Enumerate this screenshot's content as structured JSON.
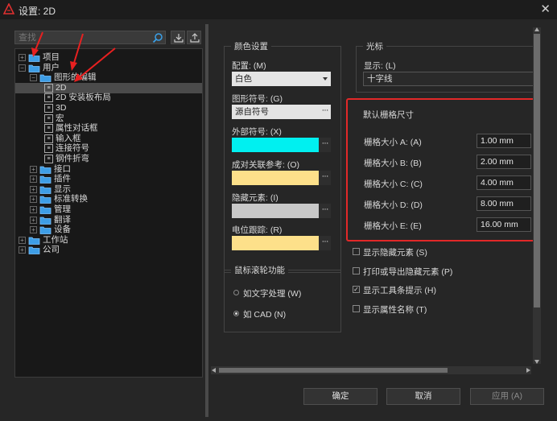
{
  "window": {
    "title": "设置: 2D",
    "close_glyph": "✕"
  },
  "toolbar": {
    "search_placeholder": "查找"
  },
  "tree": [
    {
      "label": "项目",
      "level": 0,
      "kind": "folder",
      "expander": "+"
    },
    {
      "label": "用户",
      "level": 0,
      "kind": "folder",
      "expander": "−"
    },
    {
      "label": "图形的编辑",
      "level": 1,
      "kind": "folder",
      "expander": "−"
    },
    {
      "label": "2D",
      "level": 2,
      "kind": "node",
      "selected": true
    },
    {
      "label": "2D 安装板布局",
      "level": 2,
      "kind": "node"
    },
    {
      "label": "3D",
      "level": 2,
      "kind": "node"
    },
    {
      "label": "宏",
      "level": 2,
      "kind": "node"
    },
    {
      "label": "属性对话框",
      "level": 2,
      "kind": "node"
    },
    {
      "label": "输入框",
      "level": 2,
      "kind": "node"
    },
    {
      "label": "连接符号",
      "level": 2,
      "kind": "node"
    },
    {
      "label": "钢件折弯",
      "level": 2,
      "kind": "node"
    },
    {
      "label": "接口",
      "level": 1,
      "kind": "folder",
      "expander": "+"
    },
    {
      "label": "插件",
      "level": 1,
      "kind": "folder",
      "expander": "+"
    },
    {
      "label": "显示",
      "level": 1,
      "kind": "folder",
      "expander": "+"
    },
    {
      "label": "标准转换",
      "level": 1,
      "kind": "folder",
      "expander": "+"
    },
    {
      "label": "管理",
      "level": 1,
      "kind": "folder",
      "expander": "+"
    },
    {
      "label": "翻译",
      "level": 1,
      "kind": "folder",
      "expander": "+"
    },
    {
      "label": "设备",
      "level": 1,
      "kind": "folder",
      "expander": "+"
    },
    {
      "label": "工作站",
      "level": 0,
      "kind": "folder",
      "expander": "+"
    },
    {
      "label": "公司",
      "level": 0,
      "kind": "folder",
      "expander": "+"
    }
  ],
  "color_settings": {
    "title": "颜色设置",
    "config_label": "配置: (M)",
    "config_value": "白色",
    "graphic_symbol_label": "图形符号: (G)",
    "graphic_symbol_value": "源自符号",
    "external_symbol_label": "外部符号: (X)",
    "external_symbol_color": "#00f0f0",
    "paired_ref_label": "成对关联参考: (O)",
    "paired_ref_color": "#fde08a",
    "hidden_elements_label": "隐藏元素: (I)",
    "hidden_elements_color": "#c8c8c8",
    "potential_track_label": "电位跟踪: (R)",
    "potential_track_color": "#fde08a",
    "dots": "···"
  },
  "cursor": {
    "title": "光标",
    "display_label": "显示: (L)",
    "display_value": "十字线"
  },
  "grid": {
    "title": "默认栅格尺寸",
    "sizes": [
      {
        "label": "栅格大小 A: (A)",
        "value": "1.00 mm"
      },
      {
        "label": "栅格大小 B: (B)",
        "value": "2.00 mm"
      },
      {
        "label": "栅格大小 C: (C)",
        "value": "4.00 mm"
      },
      {
        "label": "栅格大小 D: (D)",
        "value": "8.00 mm"
      },
      {
        "label": "栅格大小 E: (E)",
        "value": "16.00 mm"
      }
    ]
  },
  "checkboxes": [
    {
      "label": "显示隐藏元素 (S)",
      "checked": false
    },
    {
      "label": "打印或导出隐藏元素 (P)",
      "checked": false
    },
    {
      "label": "显示工具条提示 (H)",
      "checked": true
    },
    {
      "label": "显示属性名称 (T)",
      "checked": false
    }
  ],
  "mouse_wheel": {
    "title": "鼠标滚轮功能",
    "option_text": "如文字处理 (W)",
    "option_cad": "如 CAD  (N)",
    "selected": "cad"
  },
  "buttons": {
    "ok": "确定",
    "cancel": "取消",
    "apply": "应用 (A)"
  },
  "colors": {
    "highlight_box": "#e22828",
    "annotation_arrow": "#e82020"
  }
}
